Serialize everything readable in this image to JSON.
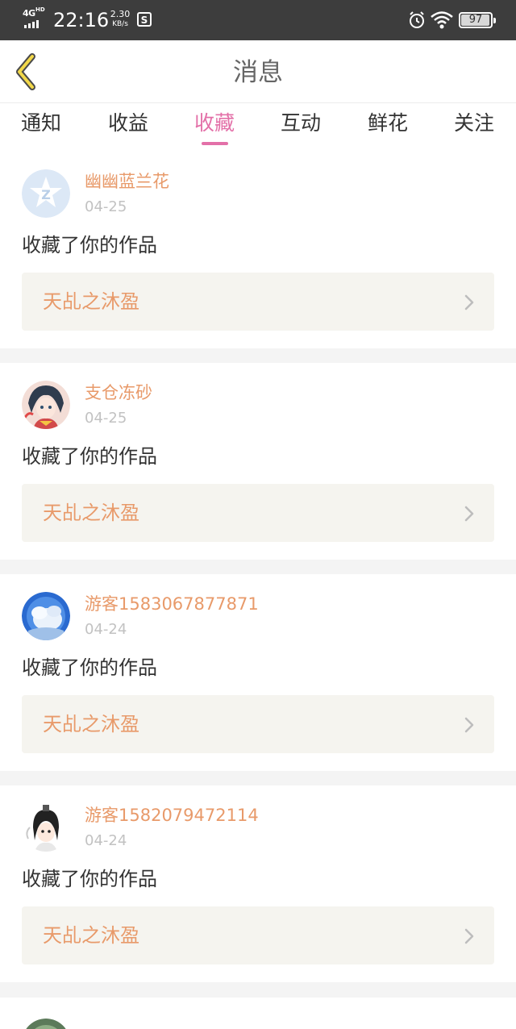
{
  "status_bar": {
    "network": "4G",
    "network_sup": "HD",
    "time": "22:16",
    "speed_value": "2.30",
    "speed_unit": "KB/s",
    "battery": "97",
    "battery_level": 0.97,
    "icons": [
      "signal-icon",
      "app-notification-icon",
      "alarm-icon",
      "wifi-icon",
      "battery-icon"
    ]
  },
  "header": {
    "title": "消息",
    "back_icon": "chevron-left-icon"
  },
  "tabs": [
    {
      "label": "通知",
      "active": false
    },
    {
      "label": "收益",
      "active": false
    },
    {
      "label": "收藏",
      "active": true
    },
    {
      "label": "互动",
      "active": false
    },
    {
      "label": "鲜花",
      "active": false
    },
    {
      "label": "关注",
      "active": false
    }
  ],
  "messages": [
    {
      "user": "幽幽蓝兰花",
      "date": "04-25",
      "text": "收藏了你的作品",
      "work": "天乩之沐盈"
    },
    {
      "user": "支仓冻砂",
      "date": "04-25",
      "text": "收藏了你的作品",
      "work": "天乩之沐盈"
    },
    {
      "user": "游客1583067877871",
      "date": "04-24",
      "text": "收藏了你的作品",
      "work": "天乩之沐盈"
    },
    {
      "user": "游客1582079472114",
      "date": "04-24",
      "text": "收藏了你的作品",
      "work": "天乩之沐盈"
    }
  ],
  "colors": {
    "accent": "#e370a8",
    "username": "#e89a6a",
    "work_box_bg": "#f5f4ef"
  }
}
